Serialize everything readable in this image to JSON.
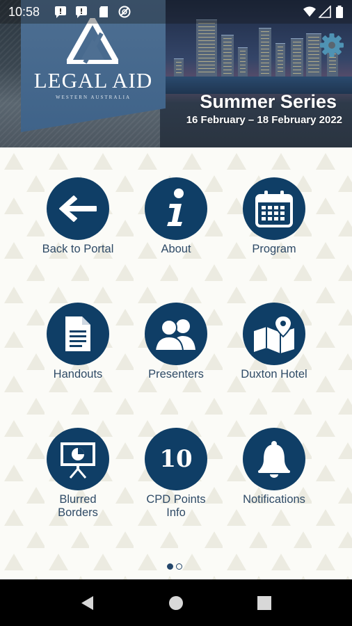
{
  "status_bar": {
    "time": "10:58"
  },
  "header": {
    "org_name": "LEGAL AID",
    "org_subtitle": "WESTERN AUSTRALIA",
    "event_title": "Summer Series",
    "event_dates": "16 February – 18 February 2022",
    "settings_icon": "gear-icon"
  },
  "menu": {
    "items": [
      {
        "label": "Back to Portal",
        "icon": "back-arrow-icon"
      },
      {
        "label": "About",
        "icon": "info-icon"
      },
      {
        "label": "Program",
        "icon": "calendar-icon"
      },
      {
        "label": "Handouts",
        "icon": "document-icon"
      },
      {
        "label": "Presenters",
        "icon": "people-icon"
      },
      {
        "label": "Duxton Hotel",
        "icon": "map-pin-icon"
      },
      {
        "label": "Blurred Borders",
        "icon": "presentation-icon"
      },
      {
        "label": "CPD Points Info",
        "icon": "number-10-icon",
        "badge": "10"
      },
      {
        "label": "Notifications",
        "icon": "bell-icon"
      }
    ]
  },
  "pagination": {
    "current_page": 1,
    "total_pages": 2
  },
  "colors": {
    "primary": "#0f3e66",
    "label": "#2e4a66",
    "banner_panel": "#4e6f92",
    "background": "#fbfbf7"
  }
}
